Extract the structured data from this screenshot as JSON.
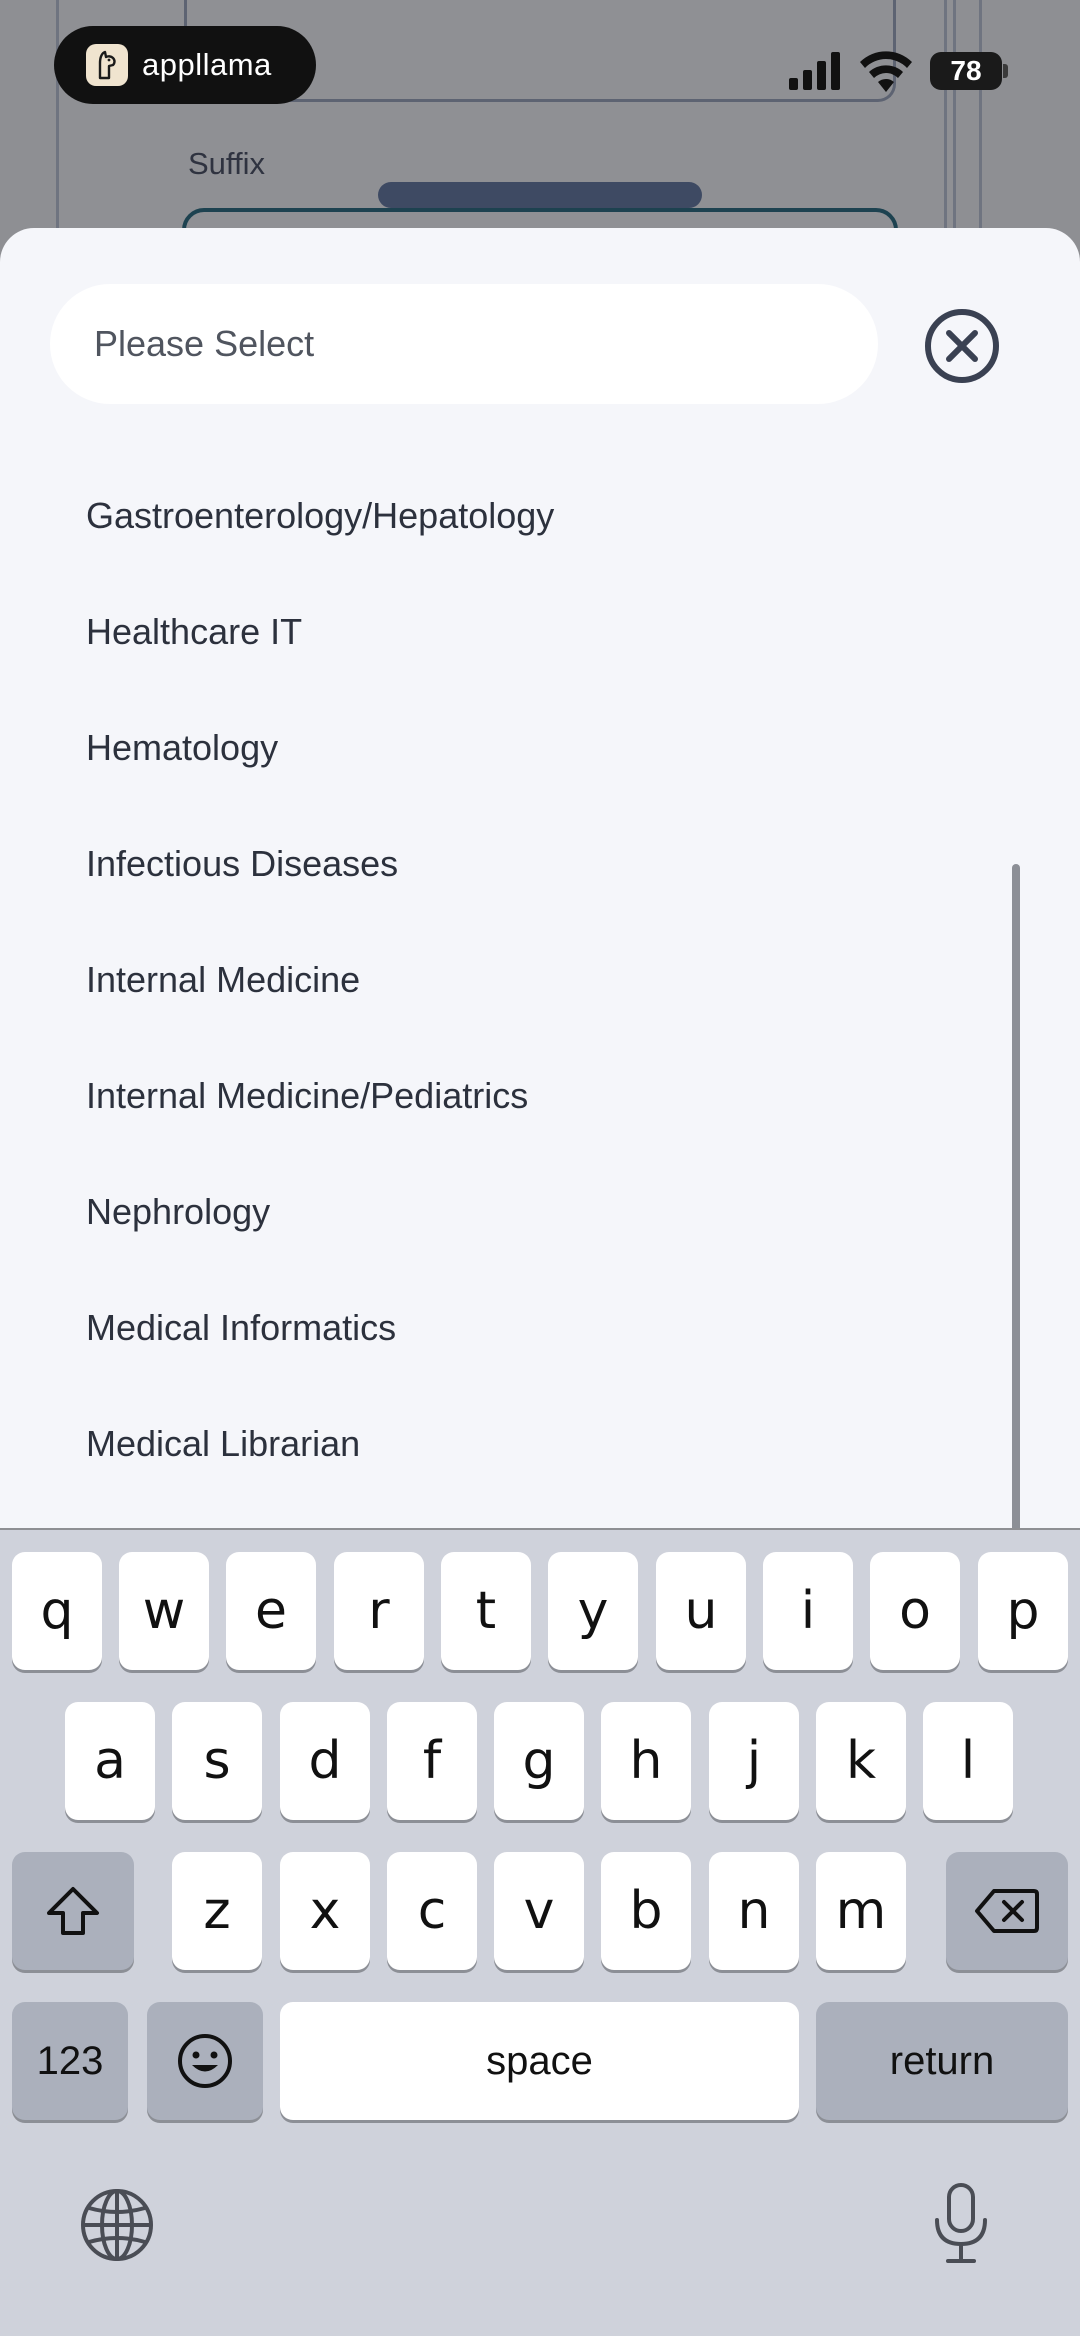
{
  "status_bar": {
    "app_name": "appllama",
    "battery": "78"
  },
  "background": {
    "field_label": "Suffix"
  },
  "sheet": {
    "search_placeholder": "Please Select",
    "items": [
      "Gastroenterology/Hepatology",
      "Healthcare IT",
      "Hematology",
      "Infectious Diseases",
      "Internal Medicine",
      "Internal Medicine/Pediatrics",
      "Nephrology",
      "Medical Informatics",
      "Medical Librarian"
    ]
  },
  "keyboard": {
    "row1": [
      "q",
      "w",
      "e",
      "r",
      "t",
      "y",
      "u",
      "i",
      "o",
      "p"
    ],
    "row2": [
      "a",
      "s",
      "d",
      "f",
      "g",
      "h",
      "j",
      "k",
      "l"
    ],
    "row3": [
      "z",
      "x",
      "c",
      "v",
      "b",
      "n",
      "m"
    ],
    "numbers_label": "123",
    "space_label": "space",
    "return_label": "return"
  },
  "colors": {
    "sheet_background": "#f5f6fa",
    "keyboard_background": "#cfd2db",
    "close_icon": "#3a4152"
  },
  "icons": [
    "app-logo-icon",
    "signal-icon",
    "wifi-icon",
    "battery-icon",
    "close-icon",
    "shift-icon",
    "backspace-icon",
    "emoji-icon",
    "globe-icon",
    "microphone-icon"
  ]
}
